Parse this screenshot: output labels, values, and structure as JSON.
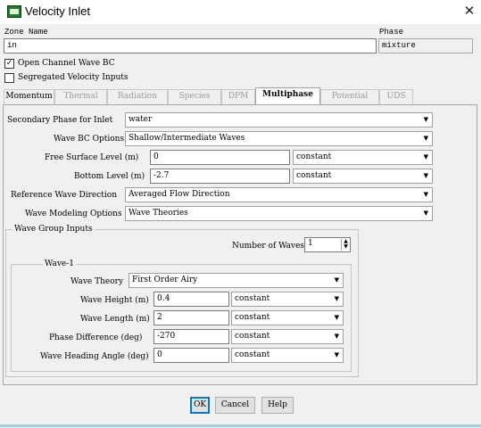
{
  "window": {
    "title": "Velocity Inlet",
    "close_glyph": "✕"
  },
  "zone": {
    "label": "Zone Name",
    "value": "in"
  },
  "phase": {
    "label": "Phase",
    "value": "mixture"
  },
  "options": {
    "open_channel": {
      "label": "Open Channel Wave BC",
      "checked": true,
      "mark": "✓"
    },
    "segregated": {
      "label": "Segregated Velocity Inputs",
      "checked": false,
      "mark": ""
    }
  },
  "tabs": [
    "Momentum",
    "Thermal",
    "Radiation",
    "Species",
    "DPM",
    "Multiphase",
    "Potential",
    "UDS"
  ],
  "active_tab": "Multiphase",
  "multiphase": {
    "secondary_phase": {
      "label": "Secondary Phase for Inlet",
      "value": "water"
    },
    "wave_bc_options": {
      "label": "Wave BC Options",
      "value": "Shallow/Intermediate Waves"
    },
    "free_surface": {
      "label": "Free Surface Level (m)",
      "value": "0",
      "method": "constant"
    },
    "bottom_level": {
      "label": "Bottom Level (m)",
      "value": "-2.7",
      "method": "constant"
    },
    "ref_wave_direction": {
      "label": "Reference Wave Direction",
      "value": "Averaged Flow Direction"
    },
    "wave_modeling": {
      "label": "Wave Modeling Options",
      "value": "Wave Theories"
    },
    "wave_group": {
      "title": "Wave Group Inputs",
      "num_waves_label": "Number of Waves",
      "num_waves_value": "1",
      "wave1": {
        "title": "Wave-1",
        "theory": {
          "label": "Wave Theory",
          "value": "First Order Airy"
        },
        "height": {
          "label": "Wave Height (m)",
          "value": "0.4",
          "method": "constant"
        },
        "length": {
          "label": "Wave Length (m)",
          "value": "2",
          "method": "constant"
        },
        "phase_diff": {
          "label": "Phase Difference (deg)",
          "value": "-270",
          "method": "constant"
        },
        "heading": {
          "label": "Wave Heading Angle (deg)",
          "value": "0",
          "method": "constant"
        }
      }
    }
  },
  "buttons": {
    "ok": "OK",
    "cancel": "Cancel",
    "help": "Help"
  },
  "icons": {
    "dropdown": "▼",
    "spin_up": "▲",
    "spin_down": "▼",
    "app": "fluent-app-icon"
  },
  "colors": {
    "accent": "#0078d7",
    "app_icon": "#1f7a2e"
  }
}
